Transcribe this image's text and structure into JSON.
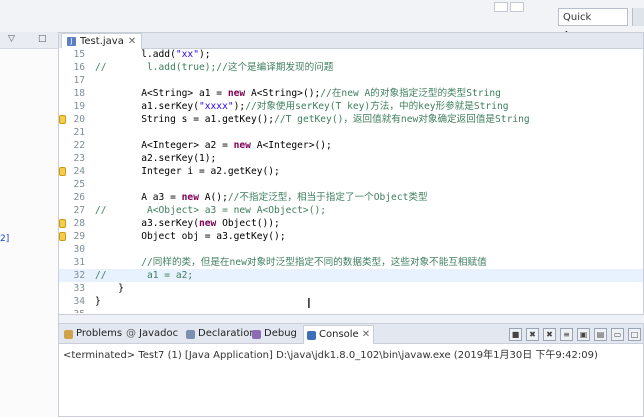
{
  "toolbar": {
    "quick_access": "Quick Access"
  },
  "left_pane": {
    "minimize": "▽",
    "maximize": "□",
    "snippet": "2]"
  },
  "editor": {
    "tab_label": "Test.java",
    "tab_close": "✕",
    "lines": [
      {
        "num": "15",
        "html": "        l.add(<span class=\"str\">\"xx\"</span>);"
      },
      {
        "num": "16",
        "html": "<span class=\"com\">//       l.add(true);//这个是编译期发现的问题</span>"
      },
      {
        "num": "17",
        "html": ""
      },
      {
        "num": "18",
        "html": "        A&lt;String&gt; a1 = <span class=\"kw\">new</span> A&lt;String&gt;();<span class=\"com\">//在new A的对象指定泛型的类型String</span>"
      },
      {
        "num": "19",
        "html": "        a1.serKey(<span class=\"str\">\"xxxx\"</span>);<span class=\"com\">//对象使用serKey(T key)方法，中的key形参就是String</span>"
      },
      {
        "num": "20",
        "html": "        String s = a1.getKey();<span class=\"com\">//T getKey()，返回值就有new对象确定返回值是String</span>"
      },
      {
        "num": "21",
        "html": ""
      },
      {
        "num": "22",
        "html": "        A&lt;Integer&gt; a2 = <span class=\"kw\">new</span> A&lt;Integer&gt;();"
      },
      {
        "num": "23",
        "html": "        a2.serKey(1);"
      },
      {
        "num": "24",
        "html": "        Integer i = a2.getKey();"
      },
      {
        "num": "25",
        "html": ""
      },
      {
        "num": "26",
        "html": "        A a3 = <span class=\"kw\">new</span> A();<span class=\"com\">//不指定泛型，相当于指定了一个Object类型</span>"
      },
      {
        "num": "27",
        "html": "<span class=\"com\">//       A&lt;Object&gt; a3 = new A&lt;Object&gt;();</span>"
      },
      {
        "num": "28",
        "html": "        a3.serKey(<span class=\"kw\">new</span> Object());"
      },
      {
        "num": "29",
        "html": "        Object obj = a3.getKey();"
      },
      {
        "num": "30",
        "html": ""
      },
      {
        "num": "31",
        "html": "        <span class=\"com\">//同样的类，但是在new对象时泛型指定不同的数据类型，这些对象不能互相赋值</span>"
      },
      {
        "num": "32",
        "html": "<span class=\"com\">//       a1 = a2;</span>"
      },
      {
        "num": "33",
        "html": "    }"
      },
      {
        "num": "34",
        "html": "}"
      },
      {
        "num": "35",
        "html": ""
      }
    ]
  },
  "bottom_tabs": [
    "Problems",
    "Javadoc",
    "Declaration",
    "Debug",
    "Console"
  ],
  "console": {
    "tab_close": "✕",
    "terminated": "<terminated> Test7 (1) [Java Application] D:\\java\\jdk1.8.0_102\\bin\\javaw.exe (2019年1月30日 下午9:42:09)"
  },
  "icons": {
    "problems": "warning-icon",
    "javadoc": "at-icon",
    "declaration": "declaration-icon",
    "debug": "debug-icon",
    "console": "console-icon",
    "file": "java-file-icon"
  },
  "colors": {
    "keyword": "#7f0055",
    "string": "#2a00ff",
    "comment": "#3f7f5f",
    "highlight": "#e8f2fe"
  }
}
